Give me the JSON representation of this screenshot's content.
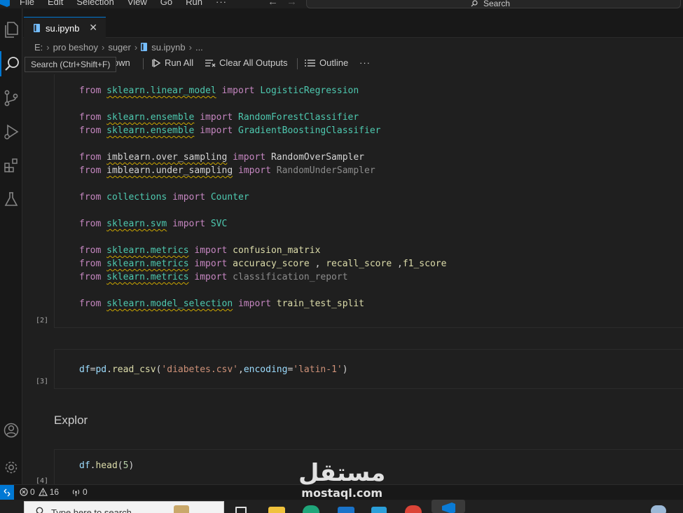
{
  "menu": {
    "items": [
      "File",
      "Edit",
      "Selection",
      "View",
      "Go",
      "Run",
      "···"
    ]
  },
  "search": {
    "label": "Search"
  },
  "tab": {
    "name": "su.ipynb",
    "close": "✕"
  },
  "breadcrumb": {
    "items": [
      "E:",
      "pro beshoy",
      "suger",
      "su.ipynb",
      "..."
    ]
  },
  "toolbar": {
    "tooltip": "Search (Ctrl+Shift+F)",
    "markdown_partial": "lown",
    "run_all": "Run All",
    "clear_outputs": "Clear All Outputs",
    "outline": "Outline",
    "more": "···"
  },
  "cells": {
    "c2": {
      "exec_count": "[2]"
    },
    "c3": {
      "exec_count": "[3]"
    },
    "md": {
      "text": "Explor"
    },
    "c4": {
      "exec_count": "[4]"
    }
  },
  "status": {
    "errors": "0",
    "warnings": "16",
    "ports": "0"
  },
  "taskbar": {
    "search_placeholder": "Type here to search"
  },
  "watermark": {
    "arabic": "مستقل",
    "latin": "mostaql.com"
  },
  "colors": {
    "accent": "#0078d4",
    "keyword": "#c586c0",
    "module": "#4ec9b0",
    "string": "#ce9178",
    "function": "#dcdcaa"
  }
}
